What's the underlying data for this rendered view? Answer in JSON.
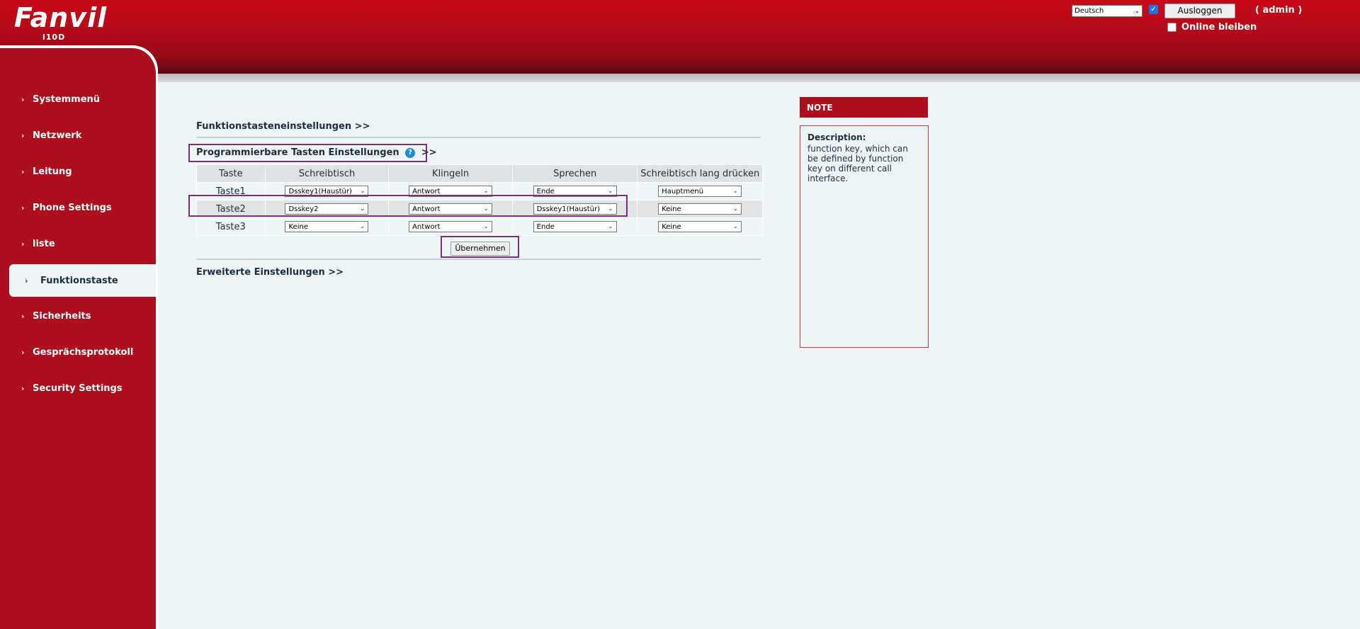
{
  "header": {
    "logo": "Fanvil",
    "model": "i10D",
    "language": "Deutsch",
    "logout_label": "Ausloggen",
    "user": "( admin )",
    "stay_online_label": "Online bleiben"
  },
  "sidebar": {
    "items": [
      {
        "label": "Systemmenü",
        "active": false
      },
      {
        "label": "Netzwerk",
        "active": false
      },
      {
        "label": "Leitung",
        "active": false
      },
      {
        "label": "Phone Settings",
        "active": false
      },
      {
        "label": "liste",
        "active": false
      },
      {
        "label": "Funktionstaste",
        "active": true
      },
      {
        "label": "Sicherheits",
        "active": false
      },
      {
        "label": "Gesprächsprotokoll",
        "active": false
      },
      {
        "label": "Security Settings",
        "active": false
      }
    ]
  },
  "main": {
    "section1": "Funktionstasteneinstellungen >>",
    "section2": {
      "title": "Programmierbare Tasten Einstellungen",
      "suffix": ">>"
    },
    "table": {
      "headers": [
        "Taste",
        "Schreibtisch",
        "Klingeln",
        "Sprechen",
        "Schreibtisch lang drücken"
      ],
      "rows": [
        {
          "key": "Taste1",
          "desk": "Dsskey1(Haustür)",
          "ring": "Antwort",
          "talk": "Ende",
          "long": "Hauptmenü"
        },
        {
          "key": "Taste2",
          "desk": "Dsskey2",
          "ring": "Antwort",
          "talk": "Dsskey1(Haustür)",
          "long": "Keine"
        },
        {
          "key": "Taste3",
          "desk": "Keine",
          "ring": "Antwort",
          "talk": "Ende",
          "long": "Keine"
        }
      ]
    },
    "apply_label": "Übernehmen",
    "section3": "Erweiterte Einstellungen >>"
  },
  "note": {
    "header": "NOTE",
    "title": "Description:",
    "text": "function key, which can be defined by function key on different call interface."
  },
  "colors": {
    "brand_red": "#ae0f1e",
    "background": "#eef5f6",
    "highlight": "#7b2d82"
  }
}
